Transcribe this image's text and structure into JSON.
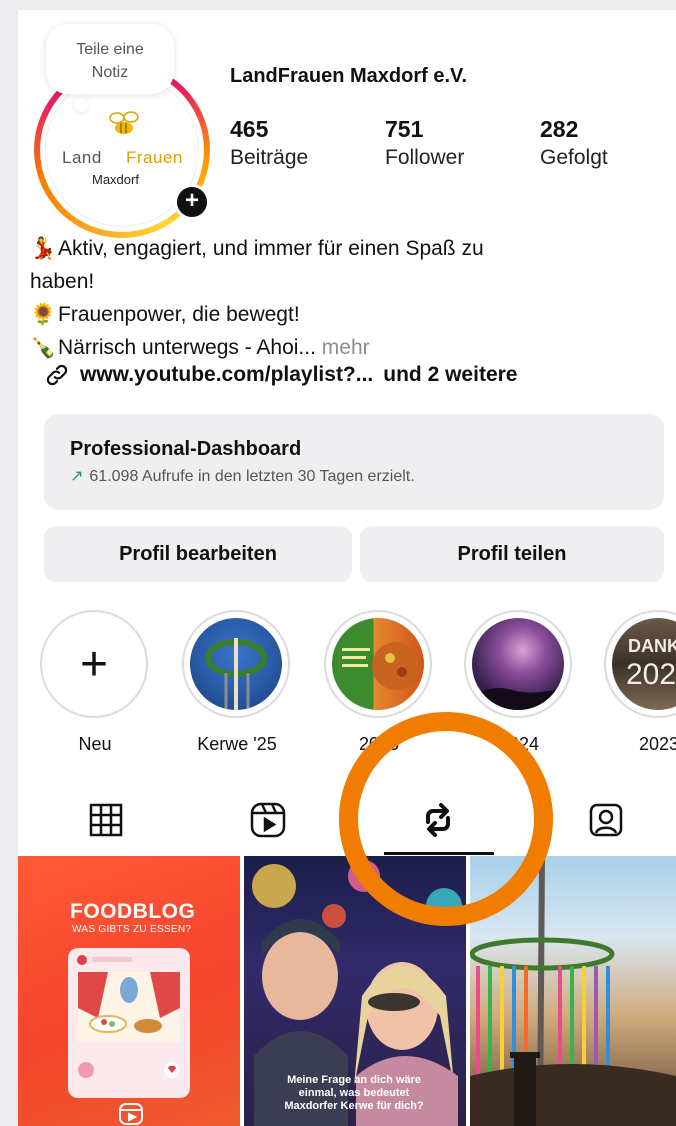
{
  "note": {
    "text_line1": "Teile eine",
    "text_line2": "Notiz"
  },
  "avatar": {
    "logo_land": "Land",
    "logo_frauen": "Frauen",
    "logo_city": "Maxdorf",
    "plus": "+"
  },
  "profile": {
    "name": "LandFrauen Maxdorf e.V.",
    "stats": [
      {
        "value": "465",
        "label": "Beiträge"
      },
      {
        "value": "751",
        "label": "Follower"
      },
      {
        "value": "282",
        "label": "Gefolgt"
      }
    ]
  },
  "bio": {
    "line1_emoji": "💃",
    "line1": "Aktiv, engagiert, und immer für einen Spaß zu",
    "line2": "haben!",
    "line3_emoji": "🌻",
    "line3": "Frauenpower, die bewegt!",
    "line4_emoji": "🍾",
    "line4": "Närrisch unterwegs - Ahoi...",
    "more": " mehr",
    "link": "www.youtube.com/playlist?...",
    "link_more": "und 2 weitere"
  },
  "dashboard": {
    "title": "Professional-Dashboard",
    "arrow": "↗",
    "subtitle": "61.098 Aufrufe in den letzten 30 Tagen erzielt."
  },
  "buttons": {
    "edit": "Profil bearbeiten",
    "share": "Profil teilen"
  },
  "highlights": [
    {
      "label": "Neu",
      "icon": "+"
    },
    {
      "label": "Kerwe '25"
    },
    {
      "label": "2025"
    },
    {
      "label": "2024"
    },
    {
      "label": "2023"
    }
  ],
  "tabs": [
    "grid-icon",
    "reels-icon",
    "reposts-icon",
    "tagged-icon"
  ],
  "grid": {
    "post1_title": "FOODBLOG",
    "post1_sub": "WAS GIBTS ZU ESSEN?",
    "post2_caption": "Meine Frage an dich wäre einmal, was bedeutet Maxdorfer Kerwe für dich?"
  },
  "colors": {
    "annotation": "#f07d00",
    "accent_green": "#1a9c4a",
    "button_bg": "#efeff2"
  }
}
